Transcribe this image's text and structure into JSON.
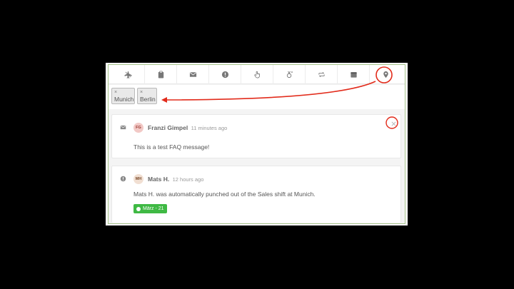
{
  "toolbar": {
    "icons": [
      "airplane-off-icon",
      "clipboard-icon",
      "envelope-icon",
      "alert-icon",
      "hand-pointer-icon",
      "medal-icon",
      "swap-icon",
      "calendar-icon",
      "location-pin-icon"
    ]
  },
  "filters": {
    "remove_symbol": "×",
    "tags": [
      "Munich",
      "Berlin"
    ]
  },
  "feed": [
    {
      "icon": "envelope-icon",
      "avatar_initials": "FG",
      "author": "Franzi Gimpel",
      "time": "11 minutes ago",
      "message": "This is a test FAQ message!"
    },
    {
      "icon": "alert-icon",
      "avatar_initials": "MH",
      "author": "Mats H.",
      "time": "12 hours ago",
      "message": "Mats H. was automatically punched out of the Sales shift at Munich.",
      "badge": "März - 21"
    }
  ],
  "colors": {
    "annotation": "#e22b1b",
    "badge_green": "#3fb944",
    "frame_border": "#a7c48c"
  }
}
